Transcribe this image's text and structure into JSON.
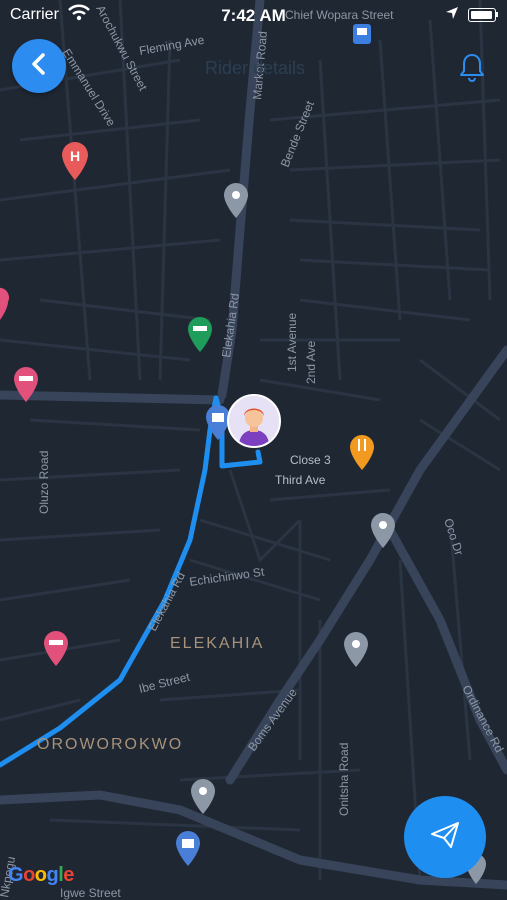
{
  "status_bar": {
    "carrier": "Carrier",
    "time": "7:42 AM"
  },
  "header": {
    "title": "Rider details"
  },
  "map": {
    "streets": [
      {
        "text": "Fleming Ave"
      },
      {
        "text": "Arochukwu Street"
      },
      {
        "text": "Emmanuel Drive"
      },
      {
        "text": "Market Road"
      },
      {
        "text": "Chief Wopara Street"
      },
      {
        "text": "Bende Street"
      },
      {
        "text": "Elekahia Rd"
      },
      {
        "text": "1st Avenue"
      },
      {
        "text": "2nd Ave"
      },
      {
        "text": "Close 3"
      },
      {
        "text": "Third Ave"
      },
      {
        "text": "Oluzo Road"
      },
      {
        "text": "Elekahia Rd"
      },
      {
        "text": "Echichinwo St"
      },
      {
        "text": "Ibe Street"
      },
      {
        "text": "Boms Avenue"
      },
      {
        "text": "Onitsha Road"
      },
      {
        "text": "Oco Dr"
      },
      {
        "text": "Ordinance Rd"
      },
      {
        "text": "Igwe Street"
      },
      {
        "text": "Nkpogu"
      }
    ],
    "areas": [
      {
        "text": "ELEKAHIA"
      },
      {
        "text": "OROWOROKWO"
      }
    ],
    "attribution": {
      "g1": "G",
      "o1": "o",
      "o2": "o",
      "g2": "g",
      "l": "l",
      "e": "e"
    }
  },
  "colors": {
    "accent": "#2d8cf0",
    "route": "#1e8ff0",
    "map_bg": "#1f2733",
    "road": "#323d4d"
  },
  "icons": {
    "back": "chevron-left-icon",
    "bell": "bell-icon",
    "send": "paper-plane-icon"
  }
}
